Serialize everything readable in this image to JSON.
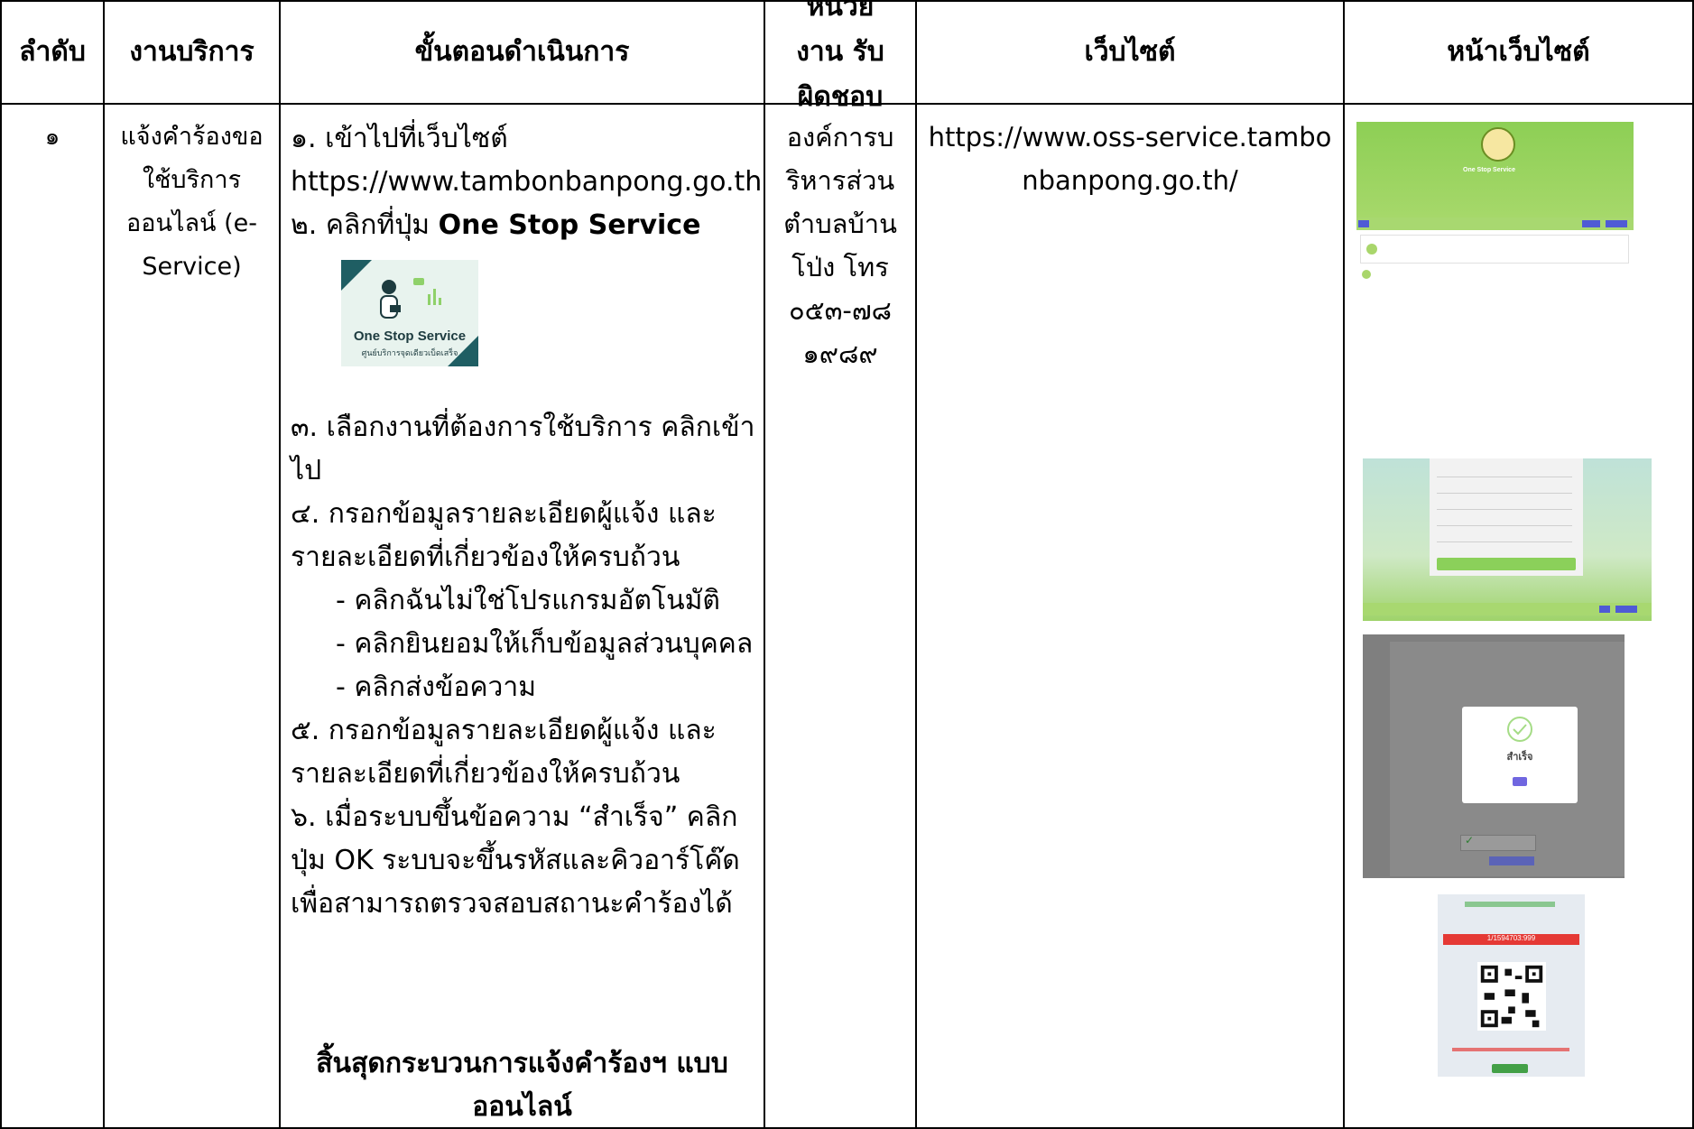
{
  "headers": {
    "no": "ลำดับ",
    "service": "งานบริการ",
    "steps": "ขั้นตอนดำเนินการ",
    "agency": "หน่วยงาน รับผิดชอบ",
    "website": "เว็บไซต์",
    "page": "หน้าเว็บไซต์"
  },
  "row": {
    "no": "๑",
    "service": "แจ้งคำร้องขอใช้บริการออนไลน์ (e-Service)",
    "steps": {
      "s1": "๑. เข้าไปที่เว็บไซต์",
      "s1_url": "https://www.tambonbanpong.go.th",
      "s2_prefix": "๒. คลิกที่ปุ่ม ",
      "s2_bold": "One Stop Service",
      "s3a": "๓. เลือกงานที่ต้องการใช้บริการ คลิกเข้า",
      "s3b": "ไป",
      "s4a": "๔. กรอกข้อมูลรายละเอียดผู้แจ้ง และ",
      "s4b": "รายละเอียดที่เกี่ยวข้องให้ครบถ้วน",
      "sub1": "- คลิกฉันไม่ใช่โปรแกรมอัตโนมัติ",
      "sub2": "- คลิกยินยอมให้เก็บข้อมูลส่วนบุคคล",
      "sub3": "- คลิกส่งข้อความ",
      "s5a": "๕. กรอกข้อมูลรายละเอียดผู้แจ้ง และ",
      "s5b": "รายละเอียดที่เกี่ยวข้องให้ครบถ้วน",
      "s6a": "๖. เมื่อระบบขึ้นข้อความ “สำเร็จ” คลิก",
      "s6b": "ปุ่ม OK ระบบจะขึ้นรหัสและคิวอาร์โค๊ด",
      "s6c": "เพื่อสามารถตรวจสอบสถานะคำร้องได้",
      "end1": "สิ้นสุดกระบวนการแจ้งคำร้องฯ แบบ",
      "end2": "ออนไลน์"
    },
    "agency": "องค์การบริหารส่วนตำบลบ้านโป่ง โทร ๐๕๓-๗๘๑๙๘๙",
    "website": "https://www.oss-service.tambonbanpong.go.th/"
  },
  "banner": {
    "title": "One Stop Service",
    "subtitle": "ศูนย์บริการจุดเดียวเบ็ดเสร็จ"
  },
  "thumbnails": {
    "modal_title": "สำเร็จ",
    "ticket_code": "1/1594703:999"
  },
  "colors": {
    "site_green": "#8dcf55",
    "button_blue": "#4f5bd5",
    "ticket_red": "#e53935",
    "banner_teal": "#1f5e63"
  }
}
